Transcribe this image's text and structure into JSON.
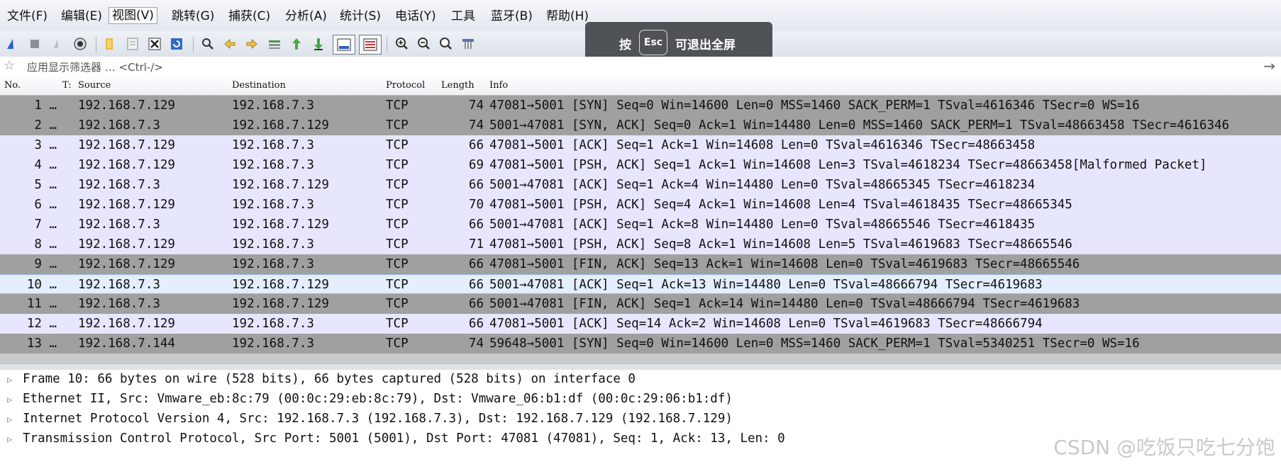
{
  "menu": {
    "items": [
      "文件(F)",
      "编辑(E)",
      "视图(V)",
      "跳转(G)",
      "捕获(C)",
      "分析(A)",
      "统计(S)",
      "电话(Y)",
      "工具",
      "蓝牙(B)",
      "帮助(H)"
    ]
  },
  "filter": {
    "label": "应用显示筛选器 … <Ctrl-/>"
  },
  "columns": {
    "no": "No.",
    "time": "T:",
    "source": "Source",
    "destination": "Destination",
    "protocol": "Protocol",
    "length": "Length",
    "info": "Info"
  },
  "packets": [
    {
      "no": "1 …",
      "src": "192.168.7.129",
      "dst": "192.168.7.3",
      "proto": "TCP",
      "len": "74",
      "info": "47081→5001 [SYN] Seq=0 Win=14600 Len=0 MSS=1460 SACK_PERM=1 TSval=4616346 TSecr=0 WS=16"
    },
    {
      "no": "2 …",
      "src": "192.168.7.3",
      "dst": "192.168.7.129",
      "proto": "TCP",
      "len": "74",
      "info": "5001→47081 [SYN, ACK] Seq=0 Ack=1 Win=14480 Len=0 MSS=1460 SACK_PERM=1 TSval=48663458 TSecr=4616346"
    },
    {
      "no": "3 …",
      "src": "192.168.7.129",
      "dst": "192.168.7.3",
      "proto": "TCP",
      "len": "66",
      "info": "47081→5001 [ACK] Seq=1 Ack=1 Win=14608 Len=0 TSval=4616346 TSecr=48663458"
    },
    {
      "no": "4 …",
      "src": "192.168.7.129",
      "dst": "192.168.7.3",
      "proto": "TCP",
      "len": "69",
      "info": "47081→5001 [PSH, ACK] Seq=1 Ack=1 Win=14608 Len=3 TSval=4618234 TSecr=48663458[Malformed Packet]"
    },
    {
      "no": "5 …",
      "src": "192.168.7.3",
      "dst": "192.168.7.129",
      "proto": "TCP",
      "len": "66",
      "info": "5001→47081 [ACK] Seq=1 Ack=4 Win=14480 Len=0 TSval=48665345 TSecr=4618234"
    },
    {
      "no": "6 …",
      "src": "192.168.7.129",
      "dst": "192.168.7.3",
      "proto": "TCP",
      "len": "70",
      "info": "47081→5001 [PSH, ACK] Seq=4 Ack=1 Win=14608 Len=4 TSval=4618435 TSecr=48665345"
    },
    {
      "no": "7 …",
      "src": "192.168.7.3",
      "dst": "192.168.7.129",
      "proto": "TCP",
      "len": "66",
      "info": "5001→47081 [ACK] Seq=1 Ack=8 Win=14480 Len=0 TSval=48665546 TSecr=4618435"
    },
    {
      "no": "8 …",
      "src": "192.168.7.129",
      "dst": "192.168.7.3",
      "proto": "TCP",
      "len": "71",
      "info": "47081→5001 [PSH, ACK] Seq=8 Ack=1 Win=14608 Len=5 TSval=4619683 TSecr=48665546"
    },
    {
      "no": "9 …",
      "src": "192.168.7.129",
      "dst": "192.168.7.3",
      "proto": "TCP",
      "len": "66",
      "info": "47081→5001 [FIN, ACK] Seq=13 Ack=1 Win=14608 Len=0 TSval=4619683 TSecr=48665546"
    },
    {
      "no": "10 …",
      "src": "192.168.7.3",
      "dst": "192.168.7.129",
      "proto": "TCP",
      "len": "66",
      "info": "5001→47081 [ACK] Seq=1 Ack=13 Win=14480 Len=0 TSval=48666794 TSecr=4619683"
    },
    {
      "no": "11 …",
      "src": "192.168.7.3",
      "dst": "192.168.7.129",
      "proto": "TCP",
      "len": "66",
      "info": "5001→47081 [FIN, ACK] Seq=1 Ack=14 Win=14480 Len=0 TSval=48666794 TSecr=4619683"
    },
    {
      "no": "12 …",
      "src": "192.168.7.129",
      "dst": "192.168.7.3",
      "proto": "TCP",
      "len": "66",
      "info": "47081→5001 [ACK] Seq=14 Ack=2 Win=14608 Len=0 TSval=4619683 TSecr=48666794"
    },
    {
      "no": "13 …",
      "src": "192.168.7.144",
      "dst": "192.168.7.3",
      "proto": "TCP",
      "len": "74",
      "info": "59648→5001 [SYN] Seq=0 Win=14600 Len=0 MSS=1460 SACK_PERM=1 TSval=5340251 TSecr=0 WS=16"
    }
  ],
  "details": [
    "Frame 10: 66 bytes on wire (528 bits), 66 bytes captured (528 bits) on interface 0",
    "Ethernet II, Src: Vmware_eb:8c:79 (00:0c:29:eb:8c:79), Dst: Vmware_06:b1:df (00:0c:29:06:b1:df)",
    "Internet Protocol Version 4, Src: 192.168.7.3 (192.168.7.3), Dst: 192.168.7.129 (192.168.7.129)",
    "Transmission Control Protocol, Src Port: 5001 (5001), Dst Port: 47081 (47081), Seq: 1, Ack: 13, Len: 0"
  ],
  "toast": {
    "before": "按",
    "key": "Esc",
    "after": "可退出全屏"
  },
  "watermark": "CSDN @吃饭只吃七分饱",
  "colors": {
    "fin_row": "#a0a0a0",
    "ack_row": "#e7e6ff",
    "selected_row": "#e4eefc"
  },
  "icons": [
    "shark-fin-start-icon",
    "stop-icon",
    "restart-icon",
    "options-icon",
    "open-folder-icon",
    "save-file-icon",
    "close-file-icon",
    "reload-icon",
    "find-icon",
    "go-back-icon",
    "go-forward-icon",
    "go-to-packet-icon",
    "go-first-icon",
    "go-last-icon",
    "autoscroll-icon",
    "colorize-icon",
    "zoom-in-icon",
    "zoom-out-icon",
    "zoom-normal-icon",
    "resize-columns-icon"
  ]
}
